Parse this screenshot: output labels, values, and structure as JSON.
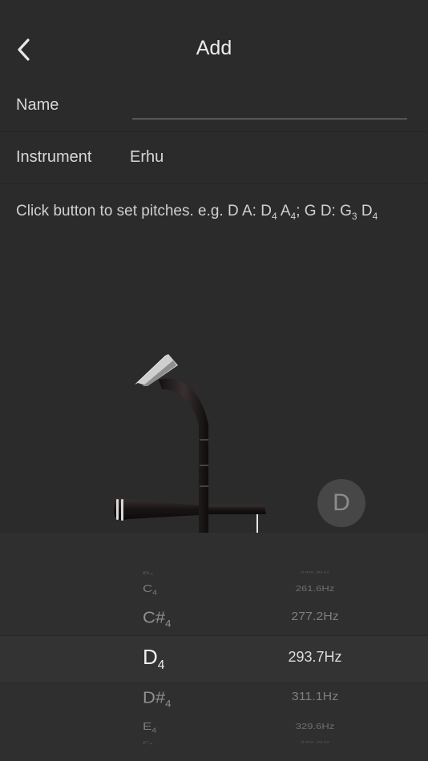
{
  "header": {
    "title": "Add"
  },
  "form": {
    "name_label": "Name",
    "name_value": "",
    "instrument_label": "Instrument",
    "instrument_value": "Erhu"
  },
  "hint": {
    "text": "Click button to set pitches. e.g. D  A: D",
    "t1": "4",
    "t2": "  A",
    "t3": "4",
    "t4": ";   G  D: G",
    "t5": "3",
    "t6": " D",
    "t7": "4"
  },
  "string_button": {
    "label": "D"
  },
  "picker": {
    "items": [
      {
        "note": "B",
        "octave": "3",
        "freq": "246.9Hz"
      },
      {
        "note": "C",
        "octave": "4",
        "freq": "261.6Hz"
      },
      {
        "note": "C#",
        "octave": "4",
        "freq": "277.2Hz"
      },
      {
        "note": "D",
        "octave": "4",
        "freq": "293.7Hz"
      },
      {
        "note": "D#",
        "octave": "4",
        "freq": "311.1Hz"
      },
      {
        "note": "E",
        "octave": "4",
        "freq": "329.6Hz"
      },
      {
        "note": "F",
        "octave": "4",
        "freq": "349.2Hz"
      }
    ],
    "selected_index": 3
  }
}
